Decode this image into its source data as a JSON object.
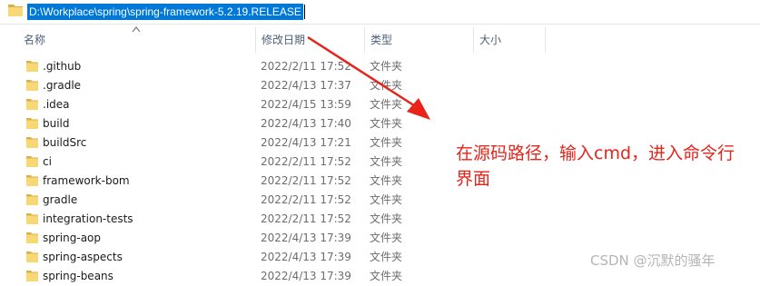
{
  "address_bar": {
    "path": "D:\\Workplace\\spring\\spring-framework-5.2.19.RELEASE",
    "folder_icon": "folder-icon"
  },
  "columns": {
    "name": "名称",
    "modified": "修改日期",
    "type": "类型",
    "size": "大小"
  },
  "files": [
    {
      "name": ".github",
      "modified": "2022/2/11 17:52",
      "type": "文件夹"
    },
    {
      "name": ".gradle",
      "modified": "2022/4/13 17:37",
      "type": "文件夹"
    },
    {
      "name": ".idea",
      "modified": "2022/4/15 13:59",
      "type": "文件夹"
    },
    {
      "name": "build",
      "modified": "2022/4/13 17:40",
      "type": "文件夹"
    },
    {
      "name": "buildSrc",
      "modified": "2022/4/13 17:21",
      "type": "文件夹"
    },
    {
      "name": "ci",
      "modified": "2022/2/11 17:52",
      "type": "文件夹"
    },
    {
      "name": "framework-bom",
      "modified": "2022/2/11 17:52",
      "type": "文件夹"
    },
    {
      "name": "gradle",
      "modified": "2022/2/11 17:52",
      "type": "文件夹"
    },
    {
      "name": "integration-tests",
      "modified": "2022/2/11 17:52",
      "type": "文件夹"
    },
    {
      "name": "spring-aop",
      "modified": "2022/4/13 17:39",
      "type": "文件夹"
    },
    {
      "name": "spring-aspects",
      "modified": "2022/4/13 17:39",
      "type": "文件夹"
    },
    {
      "name": "spring-beans",
      "modified": "2022/4/13 17:39",
      "type": "文件夹"
    }
  ],
  "annotation": {
    "text": "在源码路径，输入cmd，进入命令行界面",
    "color": "#e8231a"
  },
  "watermark": "CSDN @沉默的骚年",
  "colors": {
    "selection": "#0078d7",
    "folder": "#f8d775",
    "header_text": "#4c607a"
  }
}
